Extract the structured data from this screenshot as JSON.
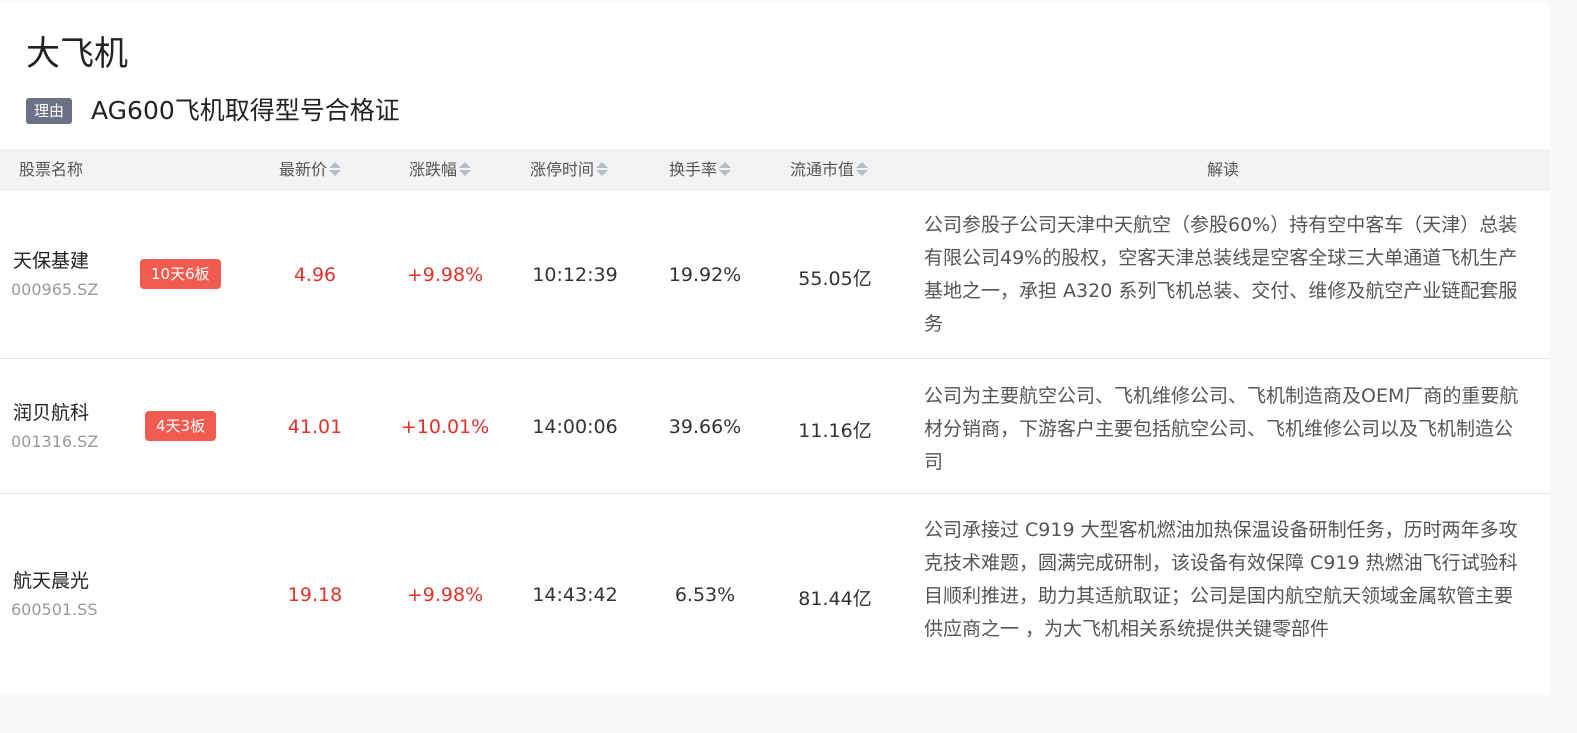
{
  "page": {
    "title": "大飞机",
    "reason_tag": "理由",
    "reason_text": "AG600飞机取得型号合格证"
  },
  "table": {
    "headers": {
      "name": "股票名称",
      "price": "最新价",
      "change": "涨跌幅",
      "limit_time": "涨停时间",
      "turnover": "换手率",
      "market_cap": "流通市值",
      "interpretation": "解读"
    },
    "rows": [
      {
        "name": "天保基建",
        "code": "000965.SZ",
        "badge": "10天6板",
        "price": "4.96",
        "change": "+9.98%",
        "limit_time": "10:12:39",
        "turnover": "19.92%",
        "market_cap": "55.05亿",
        "interpretation": "公司参股子公司天津中天航空（参股60%）持有空中客车（天津）总装有限公司49%的股权，空客天津总装线是空客全球三大单通道飞机生产基地之一，承担 A320 系列飞机总装、交付、维修及航空产业链配套服务"
      },
      {
        "name": "润贝航科",
        "code": "001316.SZ",
        "badge": "4天3板",
        "price": "41.01",
        "change": "+10.01%",
        "limit_time": "14:00:06",
        "turnover": "39.66%",
        "market_cap": "11.16亿",
        "interpretation": "公司为主要航空公司、飞机维修公司、飞机制造商及OEM厂商的重要航材分销商，下游客户主要包括航空公司、飞机维修公司以及飞机制造公司"
      },
      {
        "name": "航天晨光",
        "code": "600501.SS",
        "badge": "",
        "price": "19.18",
        "change": "+9.98%",
        "limit_time": "14:43:42",
        "turnover": "6.53%",
        "market_cap": "81.44亿",
        "interpretation": "公司承接过 C919 大型客机燃油加热保温设备研制任务，历时两年多攻克技术难题，圆满完成研制，该设备有效保障 C919 热燃油飞行试验科目顺利推进，助力其适航取证；公司是国内航空航天领域金属软管主要供应商之一 ，为大飞机相关系统提供关键零部件"
      }
    ]
  },
  "colors": {
    "up": "#e0322b",
    "badge": "#f25b50",
    "tag": "#6b7186"
  }
}
